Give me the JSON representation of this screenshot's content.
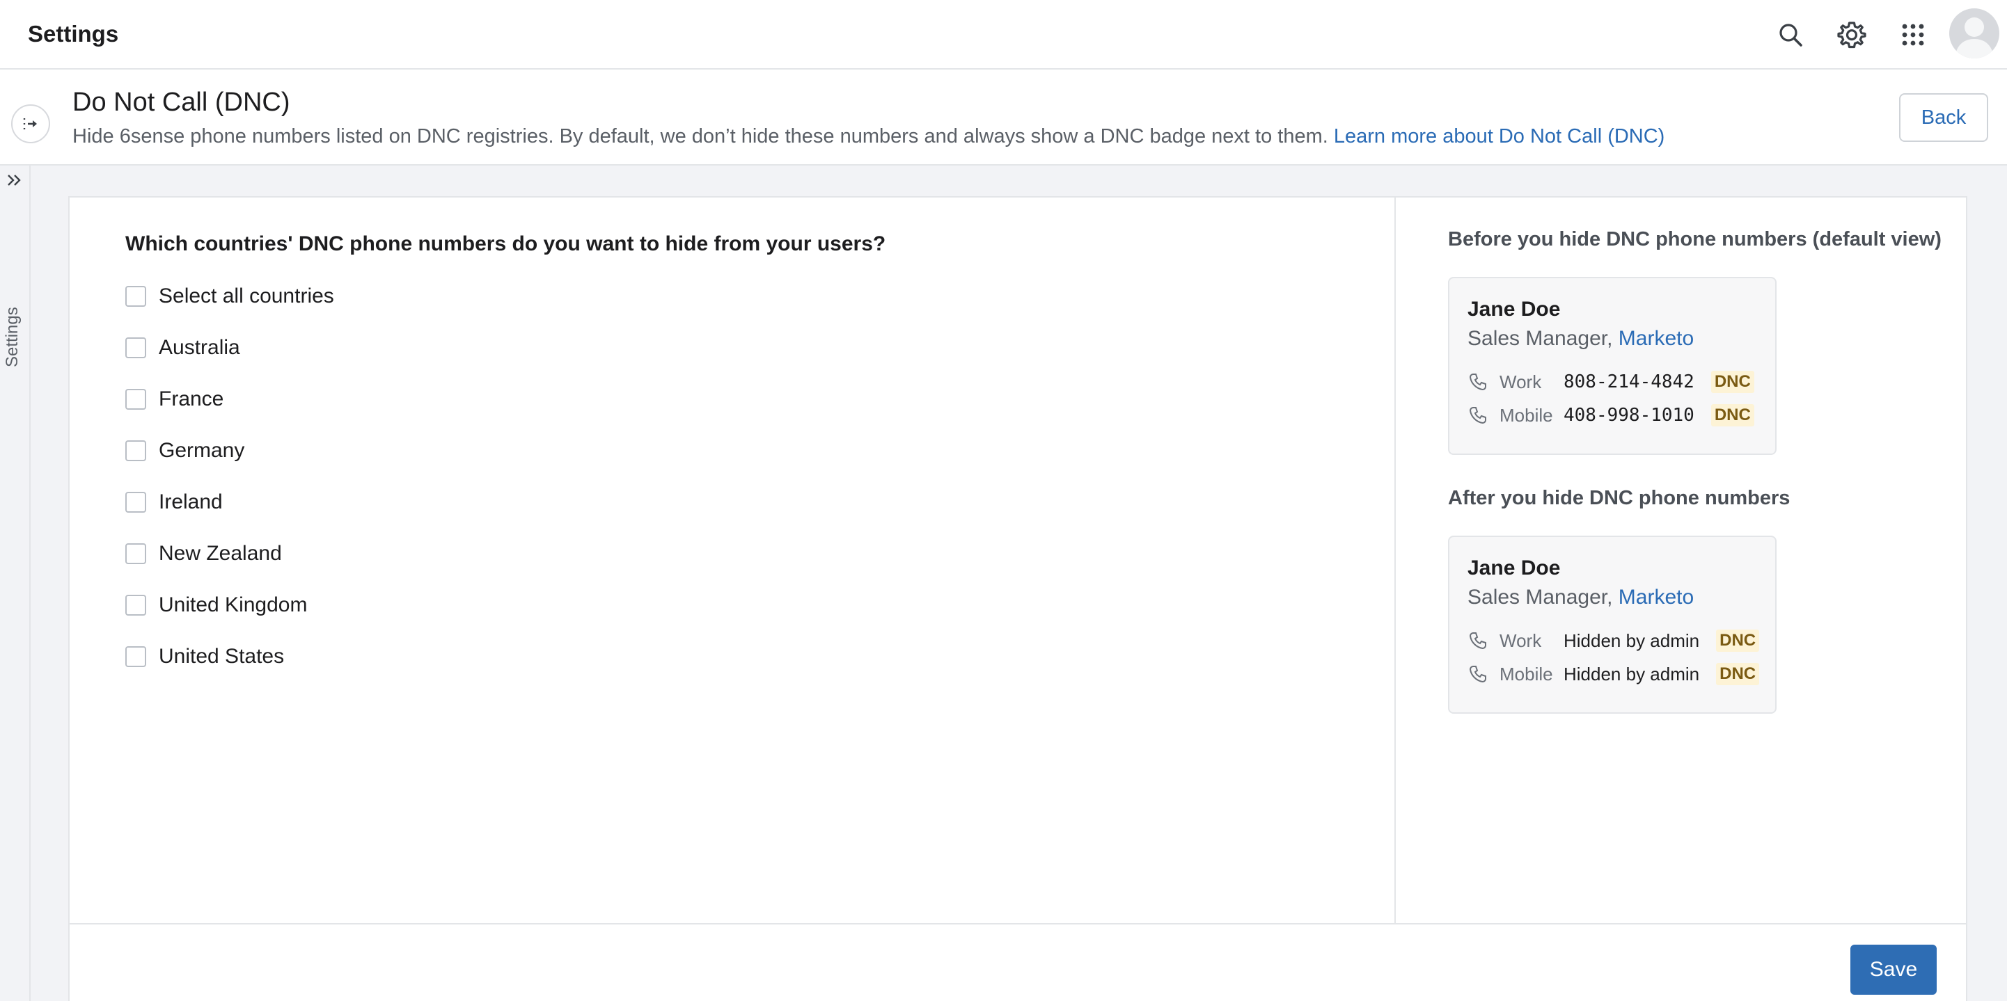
{
  "topbar": {
    "title": "Settings",
    "icons": [
      "search-icon",
      "gear-icon",
      "apps-grid-icon",
      "avatar"
    ]
  },
  "header": {
    "title": "Do Not Call (DNC)",
    "description": "Hide 6sense phone numbers listed on DNC registries. By default, we don’t hide these numbers and always show a DNC badge next to them. ",
    "learn_more_link": "Learn more about Do Not Call (DNC)",
    "back_label": "Back"
  },
  "side_rail": {
    "label": "Settings"
  },
  "countries_panel": {
    "question": "Which countries' DNC phone numbers do you want to hide from your users?",
    "options": [
      {
        "label": "Select all countries",
        "checked": false
      },
      {
        "label": "Australia",
        "checked": false
      },
      {
        "label": "France",
        "checked": false
      },
      {
        "label": "Germany",
        "checked": false
      },
      {
        "label": "Ireland",
        "checked": false
      },
      {
        "label": "New Zealand",
        "checked": false
      },
      {
        "label": "United Kingdom",
        "checked": false
      },
      {
        "label": "United States",
        "checked": false
      }
    ]
  },
  "preview": {
    "before_heading": "Before you hide DNC phone numbers (default view)",
    "after_heading": "After you hide DNC phone numbers",
    "before_card": {
      "name": "Jane Doe",
      "role": "Sales Manager, ",
      "company": "Marketo",
      "phones": [
        {
          "type": "Work",
          "value": "808-214-4842",
          "badge": "DNC"
        },
        {
          "type": "Mobile",
          "value": "408-998-1010",
          "badge": "DNC"
        }
      ]
    },
    "after_card": {
      "name": "Jane Doe",
      "role": "Sales Manager, ",
      "company": "Marketo",
      "phones": [
        {
          "type": "Work",
          "value": "Hidden by admin",
          "badge": "DNC"
        },
        {
          "type": "Mobile",
          "value": "Hidden by admin",
          "badge": "DNC"
        }
      ]
    }
  },
  "footer": {
    "save_label": "Save"
  },
  "colors": {
    "accent": "#2e6db4",
    "link": "#2a6bb5",
    "dnc_badge_bg": "#fdf3d6",
    "dnc_badge_text": "#7a5a12"
  }
}
